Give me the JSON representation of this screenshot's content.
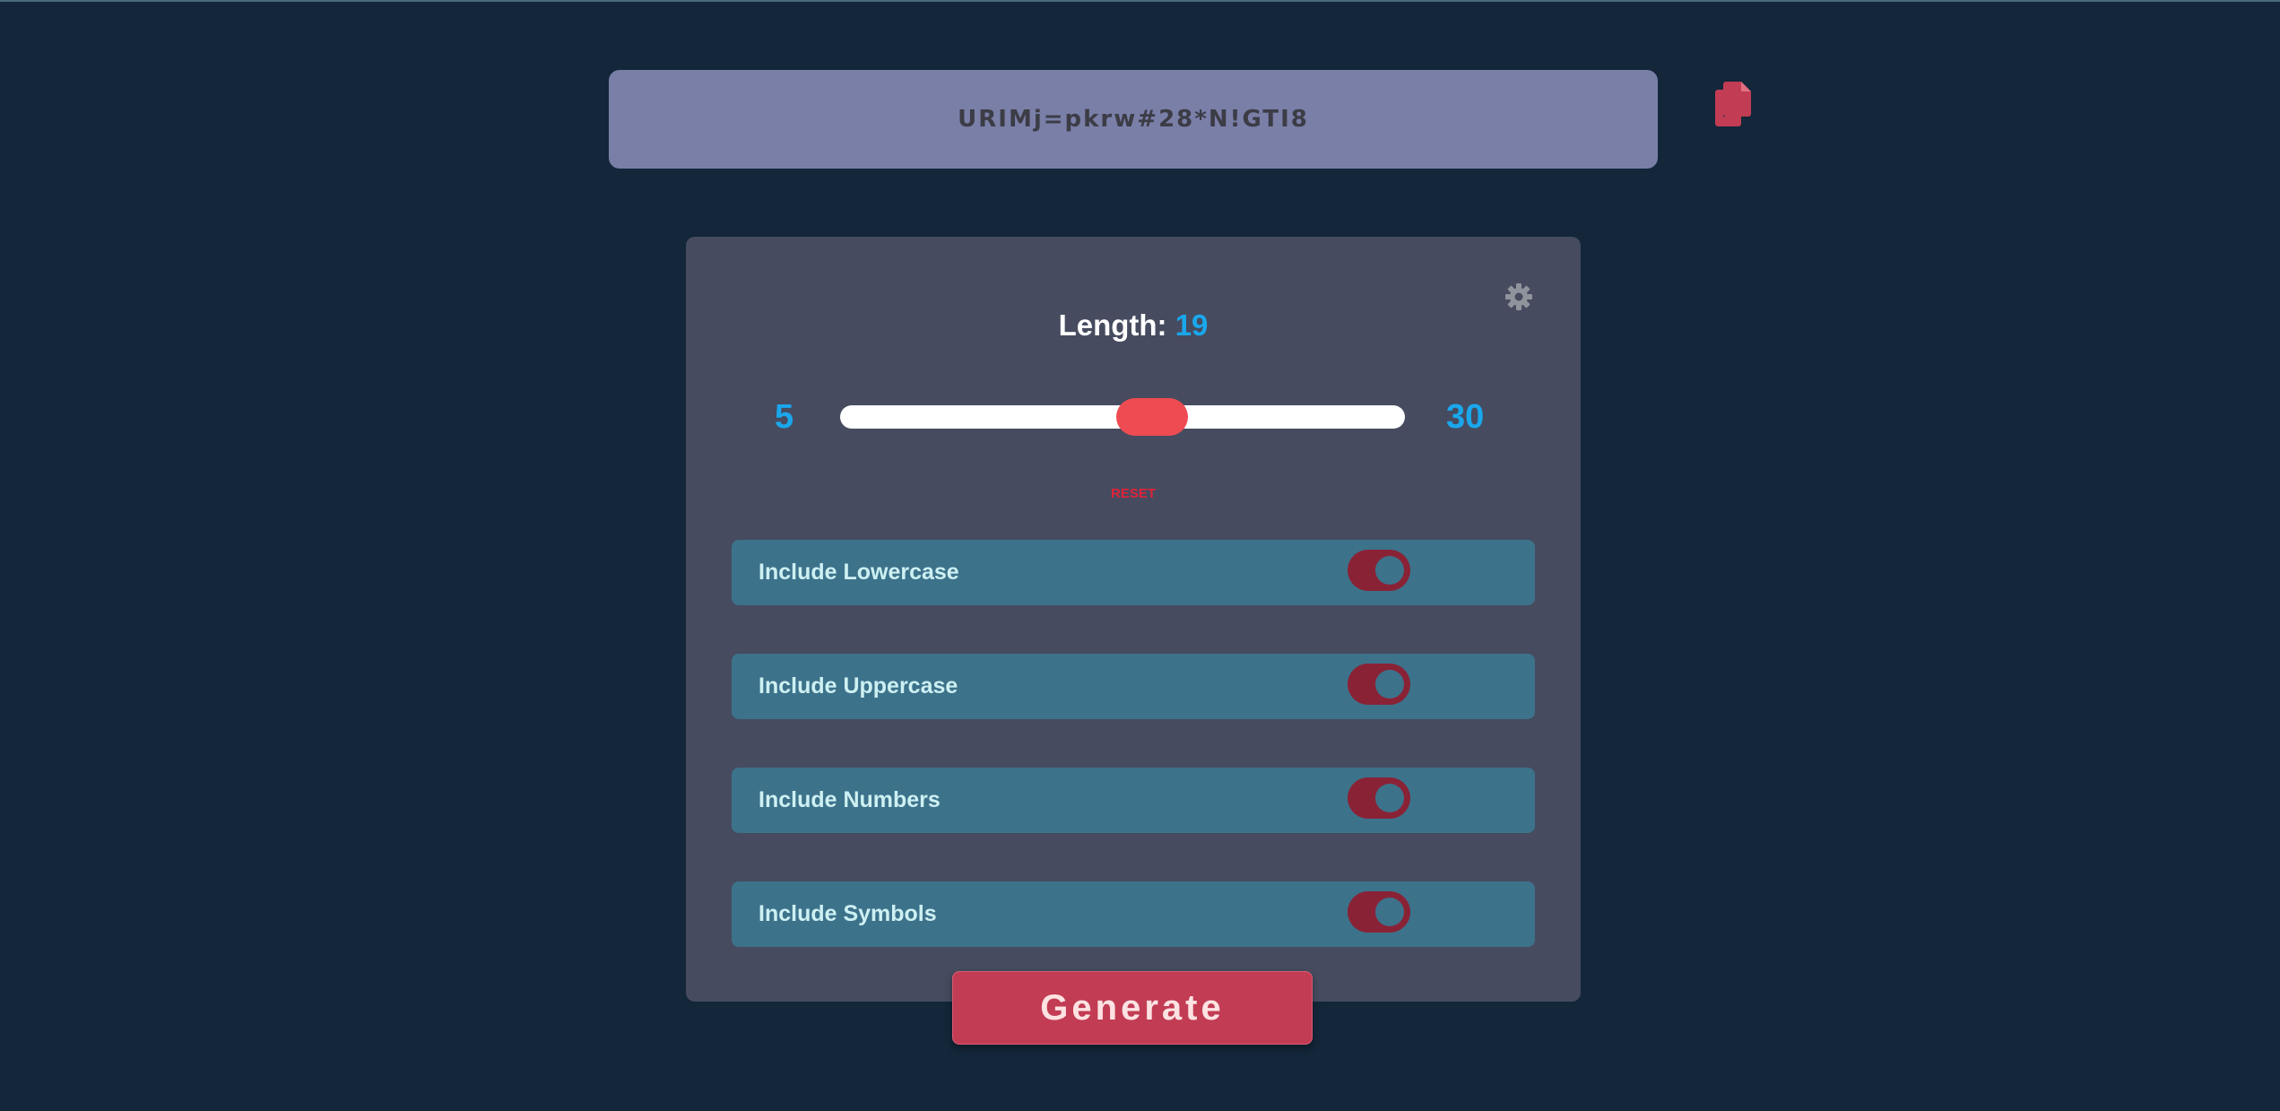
{
  "password": {
    "value": "URIMj=pkrw#28*N!GTI8"
  },
  "copy": {
    "icon": "copy-icon"
  },
  "settings": {
    "icon": "gear-icon"
  },
  "length": {
    "label": "Length: ",
    "value": "19",
    "min": "5",
    "max": "30",
    "slider_fraction": 0.56
  },
  "reset_label": "RESET",
  "options": [
    {
      "label": "Include Lowercase",
      "enabled": true
    },
    {
      "label": "Include Uppercase",
      "enabled": true
    },
    {
      "label": "Include Numbers",
      "enabled": true
    },
    {
      "label": "Include Symbols",
      "enabled": true
    }
  ],
  "generate_label": "Generate",
  "colors": {
    "background": "#13263a",
    "accent_blue": "#1aa7ec",
    "accent_red": "#c23c54",
    "toggle_on": "#8a2236",
    "panel": "#464b5f"
  }
}
